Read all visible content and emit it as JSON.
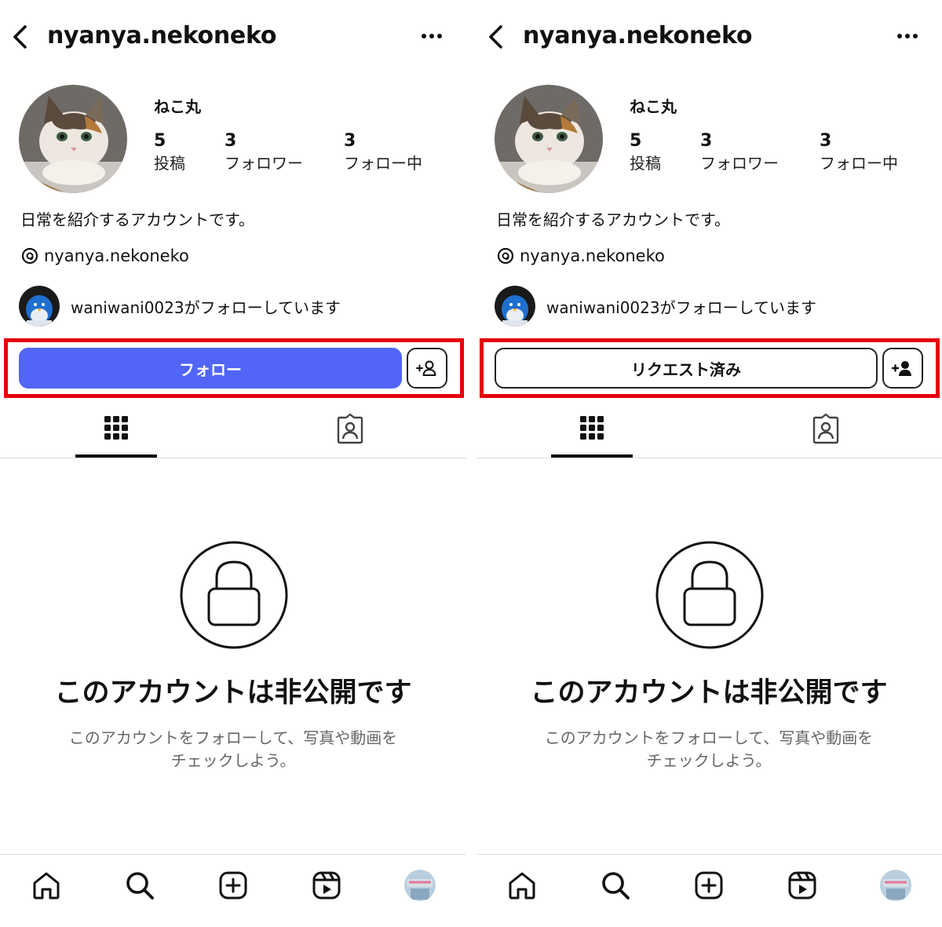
{
  "screens": [
    {
      "header": {
        "username": "nyanya.nekoneko"
      },
      "profile": {
        "display_name": "ねこ丸",
        "stats": [
          {
            "value": "5",
            "label": "投稿"
          },
          {
            "value": "3",
            "label": "フォロワー"
          },
          {
            "value": "3",
            "label": "フォロー中"
          }
        ],
        "bio": "日常を紹介するアカウントです。",
        "threads_handle": "nyanya.nekoneko",
        "followed_by": "waniwani0023がフォローしています"
      },
      "action": {
        "primary_label": "フォロー",
        "state": "not-following"
      },
      "private": {
        "title": "このアカウントは非公開です",
        "subtitle_line1": "このアカウントをフォローして、写真や動画を",
        "subtitle_line2": "チェックしよう。"
      }
    },
    {
      "header": {
        "username": "nyanya.nekoneko"
      },
      "profile": {
        "display_name": "ねこ丸",
        "stats": [
          {
            "value": "5",
            "label": "投稿"
          },
          {
            "value": "3",
            "label": "フォロワー"
          },
          {
            "value": "3",
            "label": "フォロー中"
          }
        ],
        "bio": "日常を紹介するアカウントです。",
        "threads_handle": "nyanya.nekoneko",
        "followed_by": "waniwani0023がフォローしています"
      },
      "action": {
        "primary_label": "リクエスト済み",
        "state": "requested"
      },
      "private": {
        "title": "このアカウントは非公開です",
        "subtitle_line1": "このアカウントをフォローして、写真や動画を",
        "subtitle_line2": "チェックしよう。"
      }
    }
  ],
  "icons": {
    "header": [
      "back-arrow-icon",
      "more-options-icon"
    ],
    "tabs": [
      "grid-icon",
      "tagged-icon"
    ],
    "nav": [
      "home-icon",
      "search-icon",
      "create-icon",
      "reels-icon",
      "profile-avatar"
    ],
    "private": "lock-icon"
  },
  "colors": {
    "follow_button": "#5165f6",
    "highlight_box": "#e5000a",
    "subtitle_text": "#666666"
  }
}
